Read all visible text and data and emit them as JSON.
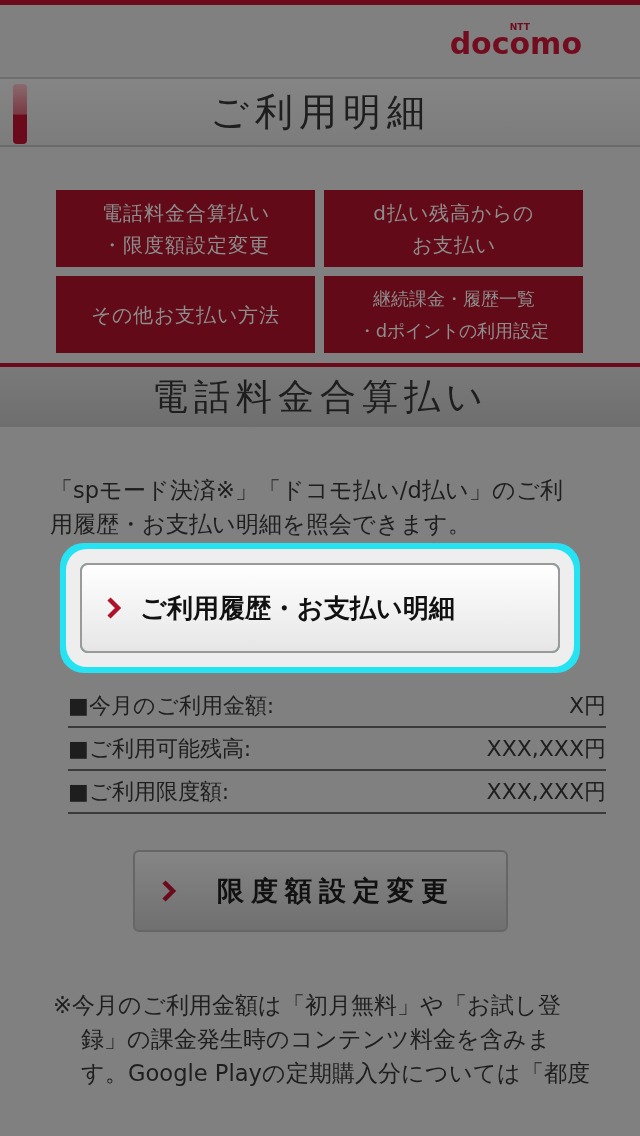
{
  "header": {
    "logo_mark": "NTT",
    "logo": "docomo"
  },
  "page_title": "ご利用明細",
  "menu_rows": [
    {
      "buttons": [
        {
          "lines": [
            "電話料金合算払い",
            "・限度額設定変更"
          ]
        },
        {
          "lines": [
            "d払い残高からの",
            "お支払い"
          ]
        }
      ]
    },
    {
      "buttons": [
        {
          "lines": [
            "その他お支払い方法"
          ]
        },
        {
          "lines": [
            "継続課金・履歴一覧",
            "・dポイントの利用設定"
          ]
        }
      ]
    }
  ],
  "section_title": "電話料金合算払い",
  "description": "「spモード決済※」「ドコモ払い/d払い」のご利用履歴・お支払い明細を照会できます。",
  "history_button": {
    "label": "ご利用履歴・お支払い明細",
    "highlighted": true
  },
  "summary": [
    {
      "label": "■今月のご利用金額:",
      "value": "X円"
    },
    {
      "label": "■ご利用可能残高:",
      "value": "XXX,XXX円"
    },
    {
      "label": "■ご利用限度額:",
      "value": "XXX,XXX円"
    }
  ],
  "limit_button": {
    "label": "限度額設定変更"
  },
  "note": "※今月のご利用金額は「初月無料」や「お試し登録」の課金発生時のコンテンツ料金を含みます。Google Playの定期購入分については「都度"
}
